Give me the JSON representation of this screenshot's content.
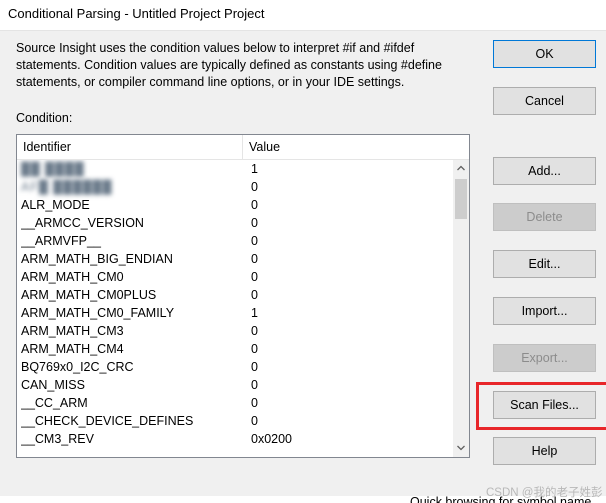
{
  "window": {
    "title": "Conditional Parsing - Untitled Project Project"
  },
  "description": "Source Insight uses the condition values below to interpret #if and #ifdef statements. Condition values are typically defined as constants using #define statements, or compiler command line options, or in your IDE settings.",
  "condition_label": "Condition:",
  "table": {
    "columns": [
      "Identifier",
      "Value"
    ],
    "rows": [
      {
        "id": "██ ████",
        "value": "1",
        "blurred": true
      },
      {
        "id": "AF█ ██████",
        "value": "0",
        "blurred": true
      },
      {
        "id": "ALR_MODE",
        "value": "0"
      },
      {
        "id": "__ARMCC_VERSION",
        "value": "0"
      },
      {
        "id": "__ARMVFP__",
        "value": "0"
      },
      {
        "id": "ARM_MATH_BIG_ENDIAN",
        "value": "0"
      },
      {
        "id": "ARM_MATH_CM0",
        "value": "0"
      },
      {
        "id": "ARM_MATH_CM0PLUS",
        "value": "0"
      },
      {
        "id": "ARM_MATH_CM0_FAMILY",
        "value": "1"
      },
      {
        "id": "ARM_MATH_CM3",
        "value": "0"
      },
      {
        "id": "ARM_MATH_CM4",
        "value": "0"
      },
      {
        "id": "BQ769x0_I2C_CRC",
        "value": "0"
      },
      {
        "id": "CAN_MISS",
        "value": "0"
      },
      {
        "id": "__CC_ARM",
        "value": "0"
      },
      {
        "id": "__CHECK_DEVICE_DEFINES",
        "value": "0"
      },
      {
        "id": "__CM3_REV",
        "value": "0x0200"
      }
    ]
  },
  "buttons": {
    "ok": "OK",
    "cancel": "Cancel",
    "add": "Add...",
    "delete": "Delete",
    "edit": "Edit...",
    "import": "Import...",
    "export": "Export...",
    "scan_files": "Scan Files...",
    "help": "Help"
  },
  "background_text": "Quick browsing for symbol name",
  "watermark": "CSDN @我的老子姓彭",
  "colors": {
    "highlight": "#e8262a",
    "default_border": "#0078d7"
  }
}
